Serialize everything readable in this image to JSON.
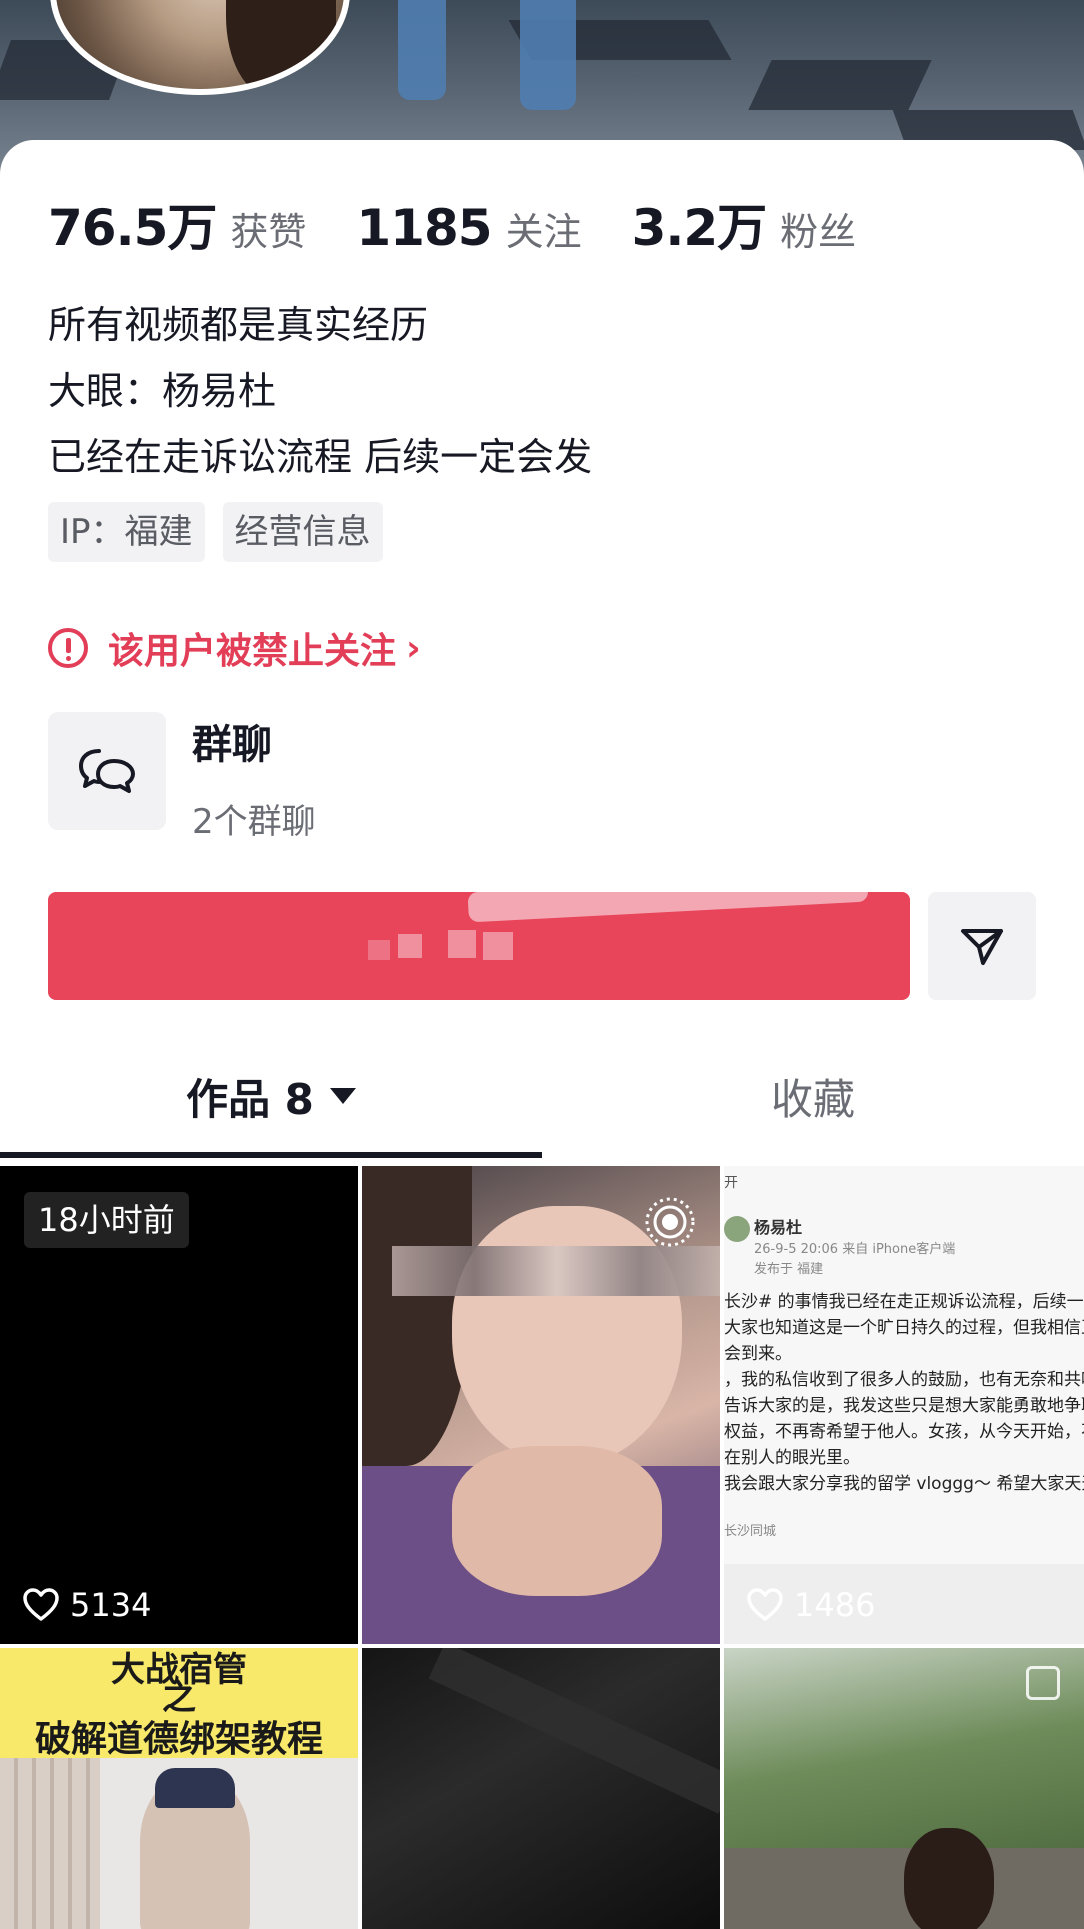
{
  "profile": {
    "stats": [
      {
        "value": "76.5万",
        "label": "获赞"
      },
      {
        "value": "1185",
        "label": "关注"
      },
      {
        "value": "3.2万",
        "label": "粉丝"
      }
    ],
    "bio_lines": [
      "所有视频都是真实经历",
      "大眼：杨易杜",
      "已经在走诉讼流程 后续一定会发"
    ],
    "tags": [
      "IP：福建",
      "经营信息"
    ],
    "warning": "该用户被禁止关注",
    "group_chat": {
      "title": "群聊",
      "subtitle": "2个群聊"
    }
  },
  "tabs": {
    "works": "作品 8",
    "favorites": "收藏"
  },
  "grid": {
    "item1": {
      "badge": "18小时前",
      "likes": "5134"
    },
    "item3": {
      "likes": "1486",
      "header": "开",
      "name": "杨易杜",
      "meta": "26-9-5 20:06  来自 iPhone客户端",
      "location": "发布于 福建",
      "lines": [
        "长沙# 的事情我已经在走正规诉讼流程，后续一定会",
        "大家也知道这是一个旷日持久的过程，但我相信正义",
        "会到来。",
        "，我的私信收到了很多人的鼓励，也有无奈和共鸣",
        "告诉大家的是，我发这些只是想大家能勇敢地争取",
        "权益，不再寄希望于他人。女孩，从今天开始，不",
        "在别人的眼光里。",
        "我会跟大家分享我的留学 vloggg～ 希望大家天天"
      ],
      "footer": "长沙同城"
    },
    "item4": {
      "line1": "大战宿管",
      "line2": "之",
      "line3": "破解道德绑架教程"
    }
  },
  "colors": {
    "accent": "#e8445a",
    "warning": "#e23e57",
    "text": "#161823",
    "muted": "#6b6d75"
  },
  "icons": [
    "heart-icon",
    "chat-bubbles-icon",
    "share-arrow-icon",
    "live-photo-icon",
    "warning-circle-icon",
    "chevron-right-icon",
    "dropdown-caret-icon"
  ]
}
